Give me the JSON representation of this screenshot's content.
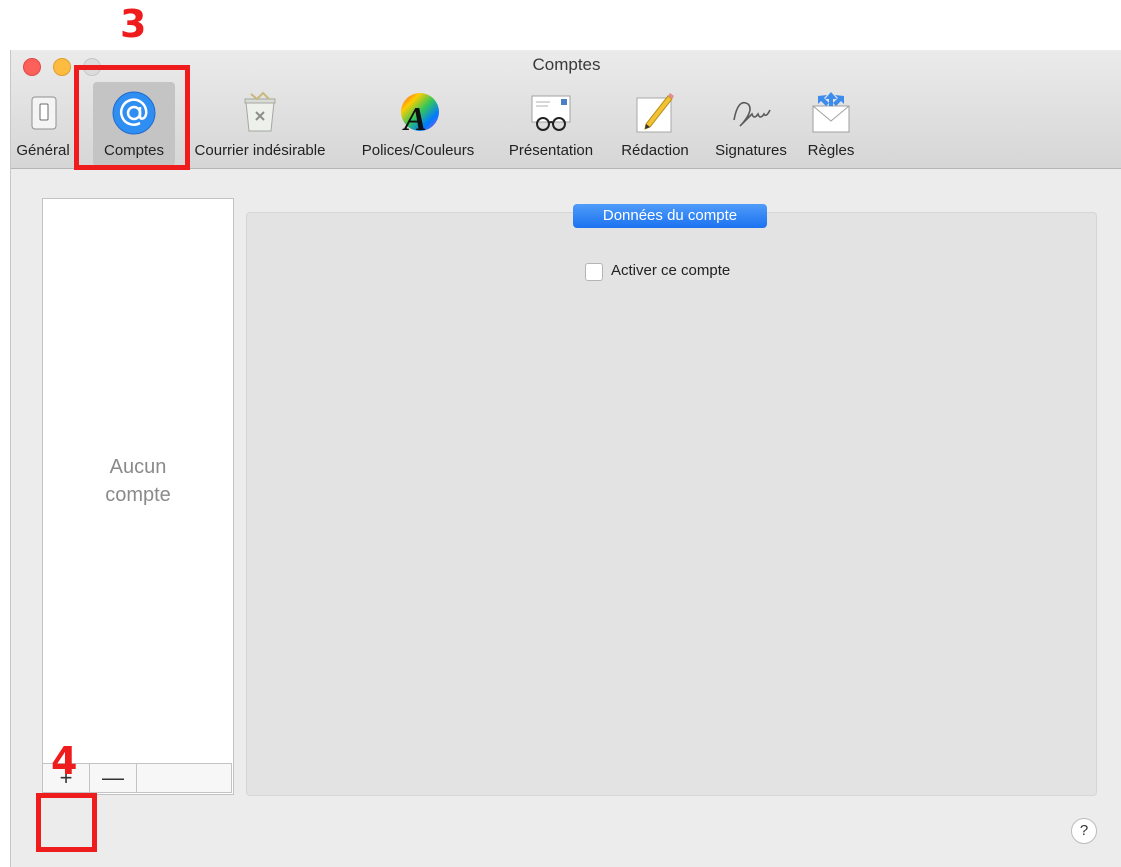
{
  "window": {
    "title": "Comptes"
  },
  "toolbar": {
    "items": [
      {
        "label": "Général",
        "icon": "general-switch-icon"
      },
      {
        "label": "Comptes",
        "icon": "at-sign-icon",
        "selected": true
      },
      {
        "label": "Courrier indésirable",
        "icon": "junk-mail-icon"
      },
      {
        "label": "Polices/Couleurs",
        "icon": "fonts-colors-icon"
      },
      {
        "label": "Présentation",
        "icon": "glasses-letter-icon"
      },
      {
        "label": "Rédaction",
        "icon": "pencil-icon"
      },
      {
        "label": "Signatures",
        "icon": "signature-icon"
      },
      {
        "label": "Règles",
        "icon": "rules-envelope-icon"
      }
    ]
  },
  "accounts": {
    "empty_text": "Aucun compte",
    "add_label": "+",
    "remove_label": "—"
  },
  "detail": {
    "tab_label": "Données du compte",
    "enable_label": "Activer ce compte",
    "enable_checked": false
  },
  "help": {
    "label": "?"
  },
  "annotations": {
    "step3": "3",
    "step4": "4",
    "color": "#ee1c1c"
  },
  "colors": {
    "accent": "#1c72f0",
    "window_bg": "#ececec",
    "panel_bg": "#e3e3e3"
  }
}
